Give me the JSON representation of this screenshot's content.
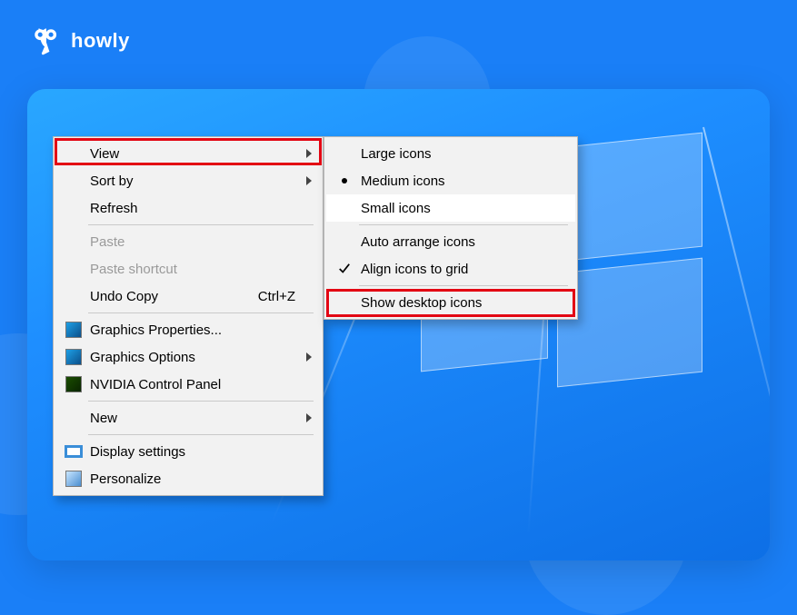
{
  "brand": {
    "name": "howly"
  },
  "context_menu": {
    "items": [
      {
        "label": "View",
        "has_submenu": true,
        "highlight": true
      },
      {
        "label": "Sort by",
        "has_submenu": true
      },
      {
        "label": "Refresh"
      },
      {
        "sep": true
      },
      {
        "label": "Paste",
        "disabled": true
      },
      {
        "label": "Paste shortcut",
        "disabled": true
      },
      {
        "label": "Undo Copy",
        "accel": "Ctrl+Z"
      },
      {
        "sep": true
      },
      {
        "label": "Graphics Properties...",
        "icon": "intel"
      },
      {
        "label": "Graphics Options",
        "icon": "intel",
        "has_submenu": true
      },
      {
        "label": "NVIDIA Control Panel",
        "icon": "nvidia"
      },
      {
        "sep": true
      },
      {
        "label": "New",
        "has_submenu": true
      },
      {
        "sep": true
      },
      {
        "label": "Display settings",
        "icon": "display"
      },
      {
        "label": "Personalize",
        "icon": "personalize"
      }
    ]
  },
  "view_submenu": {
    "items": [
      {
        "label": "Large icons"
      },
      {
        "label": "Medium icons",
        "bullet": true
      },
      {
        "label": "Small icons",
        "highlighted": true
      },
      {
        "sep": true
      },
      {
        "label": "Auto arrange icons"
      },
      {
        "label": "Align icons to grid",
        "checked": true
      },
      {
        "sep": true
      },
      {
        "label": "Show desktop icons",
        "redbox": true
      }
    ]
  }
}
